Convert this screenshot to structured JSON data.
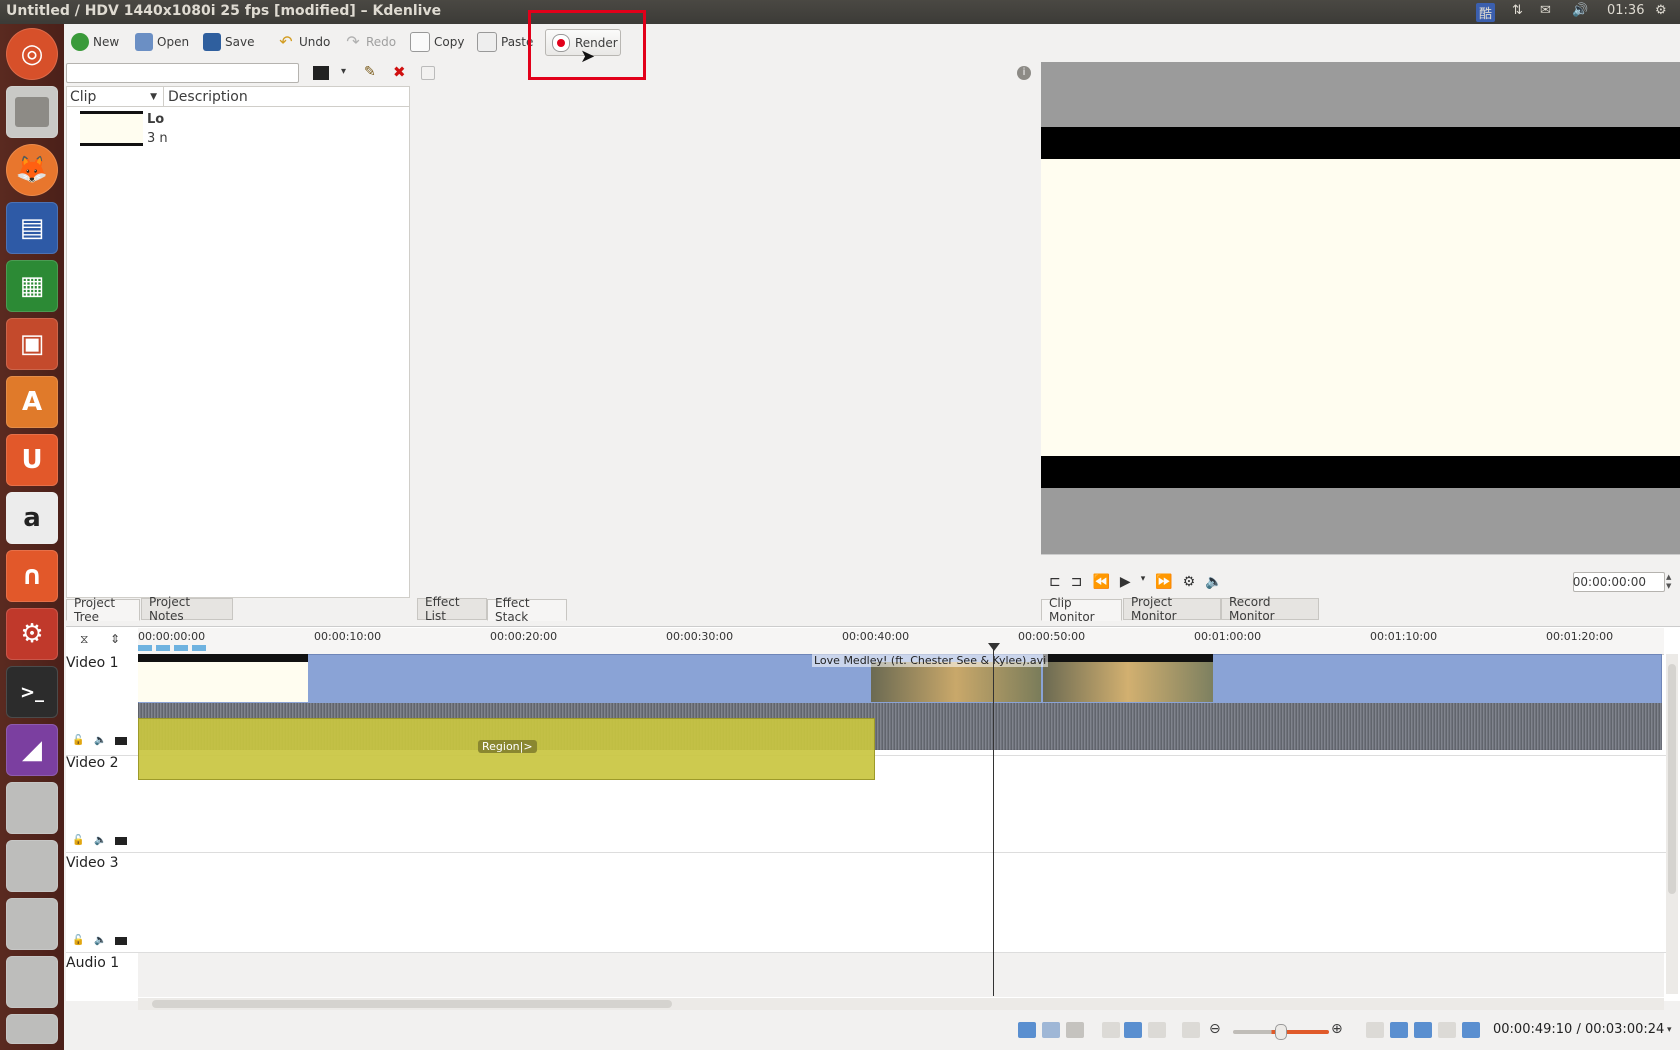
{
  "window": {
    "title": "Untitled / HDV 1440x1080i 25 fps [modified] – Kdenlive"
  },
  "indicators": {
    "keyboard": "酷",
    "time": "01:36"
  },
  "launcher": {
    "items": [
      "ubuntu-dash",
      "files",
      "firefox",
      "writer",
      "calc",
      "impress",
      "software-center",
      "ubuntu-one",
      "amazon",
      "ubuntu-one-music",
      "system-settings",
      "terminal",
      "kdenlive",
      "drive",
      "drive",
      "drive",
      "drive",
      "trash"
    ]
  },
  "toolbar": {
    "new_label": "New",
    "open_label": "Open",
    "save_label": "Save",
    "undo_label": "Undo",
    "redo_label": "Redo",
    "copy_label": "Copy",
    "paste_label": "Paste",
    "render_label": "Render"
  },
  "project_tree": {
    "search_value": "",
    "headers": {
      "clip": "Clip",
      "description": "Description"
    },
    "clip": {
      "name": "Lo",
      "duration": "3 n"
    },
    "tabs": [
      "Project Tree",
      "Project Notes"
    ]
  },
  "effects": {
    "tabs": [
      "Effect List",
      "Effect Stack"
    ]
  },
  "monitor": {
    "timecode": "00:00:00:00",
    "tabs": [
      "Clip Monitor",
      "Project Monitor",
      "Record Monitor"
    ]
  },
  "timeline": {
    "ruler": [
      "00:00:00:00",
      "00:00:10:00",
      "00:00:20:00",
      "00:00:30:00",
      "00:00:40:00",
      "00:00:50:00",
      "00:01:00:00",
      "00:01:10:00",
      "00:01:20:00"
    ],
    "tracks": [
      "Video 1",
      "Video 2",
      "Video 3",
      "Audio 1"
    ],
    "clip_label": "Love Medley! (ft. Chester See & Kylee).avi",
    "region_label": "Region|>"
  },
  "status": {
    "position": "00:00:49:10",
    "duration": "00:03:00:24",
    "separator": " / "
  },
  "colors": {
    "highlight": "#e2001a",
    "clip_blue": "#8aa3d6",
    "region_yellow": "#c9c640"
  }
}
